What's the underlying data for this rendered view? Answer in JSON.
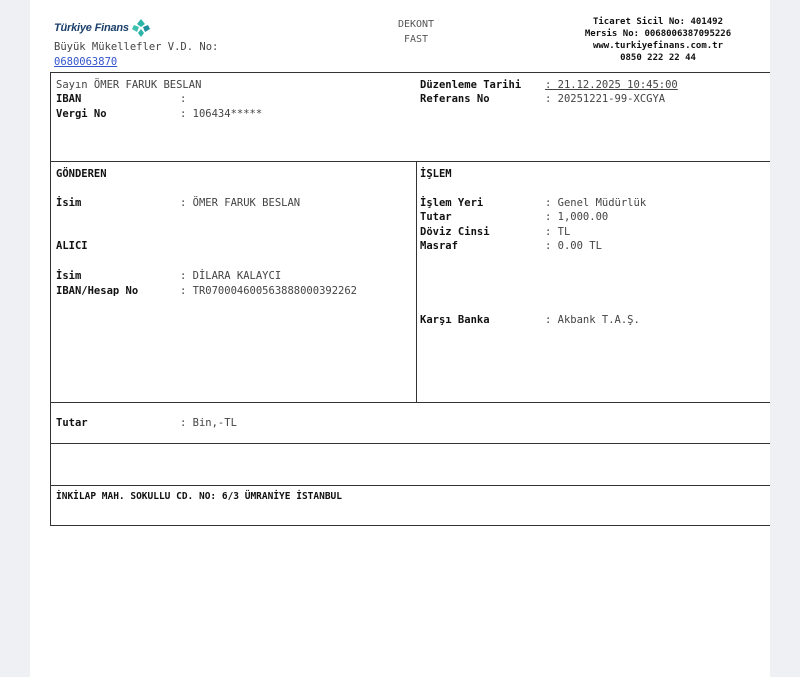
{
  "header": {
    "logo_text": "Türkiye Finans",
    "tax_office_label": "Büyük Mükellefler V.D. No:",
    "tax_office_no": "0680063870",
    "doc_title": "DEKONT",
    "doc_subtitle": "FAST",
    "trade_registry": "Ticaret Sicil No: 401492",
    "mersis": "Mersis No: 0068006387095226",
    "website": "www.turkiyefinans.com.tr",
    "phone": "0850 222 22 44"
  },
  "customer": {
    "greeting": "Sayın ÖMER FARUK BESLAN",
    "iban_label": "IBAN",
    "iban_value": ":",
    "tax_no_label": "Vergi No",
    "tax_no_value": ": 106434*****",
    "date_label": "Düzenleme Tarihi",
    "date_value": ": 21.12.2025 10:45:00",
    "ref_label": "Referans No",
    "ref_value": ": 20251221-99-XCGYA"
  },
  "sender": {
    "section_title": "GÖNDEREN",
    "name_label": "İsim",
    "name_value": ": ÖMER FARUK BESLAN"
  },
  "receiver": {
    "section_title": "ALICI",
    "name_label": "İsim",
    "name_value": ": DİLARA KALAYCI",
    "iban_label": "IBAN/Hesap No",
    "iban_value": ": TR070004600563888000392262"
  },
  "transaction": {
    "section_title": "İŞLEM",
    "place_label": "İşlem Yeri",
    "place_value": ": Genel Müdürlük",
    "amount_label": "Tutar",
    "amount_value": ": 1,000.00",
    "currency_label": "Döviz Cinsi",
    "currency_value": ": TL",
    "fee_label": "Masraf",
    "fee_value": ": 0.00 TL",
    "bank_label": "Karşı Banka",
    "bank_value": ": Akbank T.A.Ş."
  },
  "total": {
    "label": "Tutar",
    "value": ": Bin,-TL"
  },
  "address": "İNKİLAP MAH. SOKULLU CD. NO: 6/3 ÜMRANİYE İSTANBUL",
  "colors": {
    "logo": "#1b3f6b",
    "logo_icon": "#2bb5a8",
    "link": "#3355cc"
  }
}
